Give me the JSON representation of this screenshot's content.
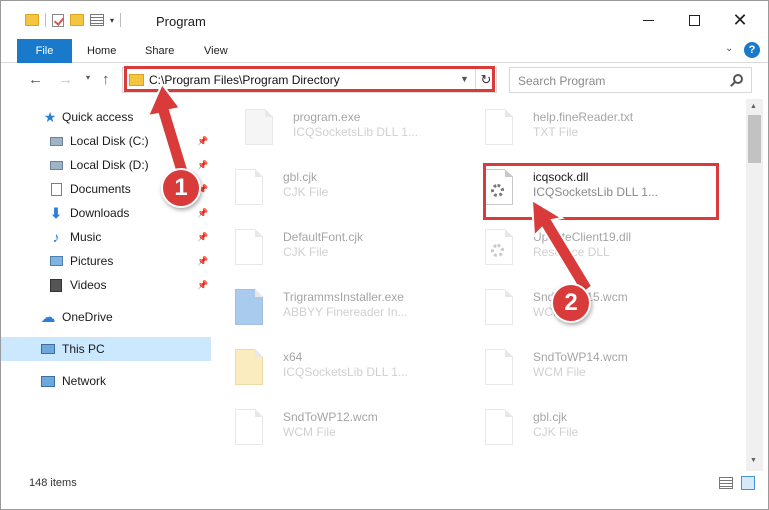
{
  "window": {
    "title": "Program",
    "minimize_label": "Minimize",
    "maximize_label": "Maximize",
    "close_label": "Close"
  },
  "ribbon": {
    "tabs": [
      {
        "label": "File"
      },
      {
        "label": "Home"
      },
      {
        "label": "Share"
      },
      {
        "label": "View"
      }
    ]
  },
  "navbar": {
    "address_path": "C:\\Program Files\\Program Directory",
    "search_placeholder": "Search Program"
  },
  "sidebar": {
    "items": [
      {
        "label": "Quick access",
        "icon": "star-icon",
        "pinned": false
      },
      {
        "label": "Local Disk (C:)",
        "icon": "drive-icon",
        "pinned": true
      },
      {
        "label": "Local Disk (D:)",
        "icon": "drive-icon",
        "pinned": true
      },
      {
        "label": "Documents",
        "icon": "document-icon",
        "pinned": true
      },
      {
        "label": "Downloads",
        "icon": "download-icon",
        "pinned": true
      },
      {
        "label": "Music",
        "icon": "music-icon",
        "pinned": true
      },
      {
        "label": "Pictures",
        "icon": "pictures-icon",
        "pinned": true
      },
      {
        "label": "Videos",
        "icon": "video-icon",
        "pinned": true
      },
      {
        "label": "OneDrive",
        "icon": "cloud-icon",
        "pinned": false
      },
      {
        "label": "This PC",
        "icon": "computer-icon",
        "pinned": false,
        "selected": true
      },
      {
        "label": "Network",
        "icon": "network-icon",
        "pinned": false
      }
    ]
  },
  "files": [
    {
      "name": "program.exe",
      "type": "ICQSocketsLib DLL 1...",
      "icon": "exe-icon"
    },
    {
      "name": "help.fineReader.txt",
      "type": "TXT File",
      "icon": "text-file-icon"
    },
    {
      "name": "gbl.cjk",
      "type": "CJK File",
      "icon": "file-icon"
    },
    {
      "name": "icqsock.dll",
      "type": "ICQSocketsLib DLL 1...",
      "icon": "dll-gear-icon",
      "highlighted": true
    },
    {
      "name": "DefaultFont.cjk",
      "type": "CJK File",
      "icon": "file-icon"
    },
    {
      "name": "UpdateClient19.dll",
      "type": "Resource DLL",
      "icon": "dll-gear-icon"
    },
    {
      "name": "TrigrammsInstaller.exe",
      "type": "ABBYY Finereader In...",
      "icon": "app-icon"
    },
    {
      "name": "SndToWP15.wcm",
      "type": "WCM File",
      "icon": "file-icon"
    },
    {
      "name": "x64",
      "type": "ICQSocketsLib DLL 1...",
      "icon": "folder-icon"
    },
    {
      "name": "SndToWP14.wcm",
      "type": "WCM File",
      "icon": "file-icon"
    },
    {
      "name": "SndToWP12.wcm",
      "type": "WCM File",
      "icon": "file-icon"
    },
    {
      "name": "gbl.cjk",
      "type": "CJK File",
      "icon": "file-icon"
    }
  ],
  "status": {
    "item_count": "148 items"
  },
  "callouts": [
    {
      "label": "1"
    },
    {
      "label": "2"
    }
  ],
  "colors": {
    "accent": "#1979ca",
    "highlight": "#d93a3a",
    "selected": "#cce8ff"
  }
}
